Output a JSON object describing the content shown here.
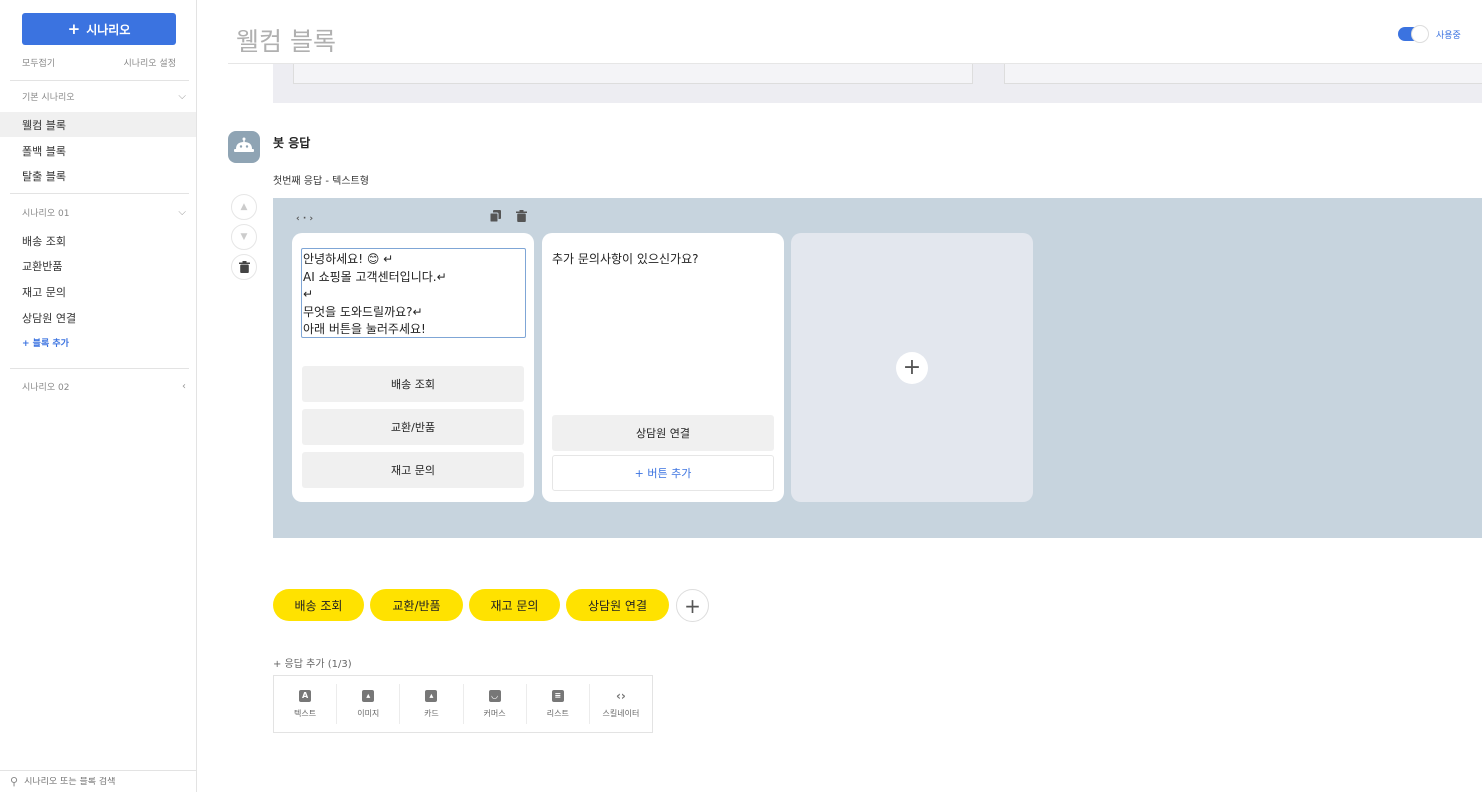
{
  "sidebar": {
    "new_button": "시나리오",
    "collapse_all": "모두접기",
    "scenario_settings": "시나리오 설정",
    "groups": [
      {
        "title": "기본 시나리오",
        "items": [
          "웰컴 블록",
          "폴백 블록",
          "탈출 블록"
        ]
      },
      {
        "title": "시나리오 01",
        "items": [
          "배송 조회",
          "교환반품",
          "재고 문의",
          "상담원 연결"
        ],
        "add_label": "+ 블록 추가"
      },
      {
        "title": "시나리오 02"
      }
    ],
    "search_placeholder": "시나리오 또는 블록 검색"
  },
  "header": {
    "title": "웰컴 블록",
    "toggle_label": "사용중"
  },
  "bot": {
    "label": "봇 응답",
    "response_label": "첫번째 응답 - 텍스트형",
    "cards": [
      {
        "text": "안녕하세요! 😊 ↵\nAI 쇼핑몰 고객센터입니다.↵\n↵\n무엇을 도와드릴까요?↵\n아래 버튼을 눌러주세요!",
        "buttons": [
          "배송 조회",
          "교환/반품",
          "재고 문의"
        ]
      },
      {
        "text": "추가 문의사항이 있으신가요?",
        "buttons": [
          "상담원 연결"
        ],
        "add_button": "+ 버튼 추가"
      }
    ]
  },
  "quick_replies": [
    "배송 조회",
    "교환/반품",
    "재고 문의",
    "상담원 연결"
  ],
  "add_response": {
    "label": "+ 응답 추가 (1/3)",
    "types": [
      "텍스트",
      "이미지",
      "카드",
      "커머스",
      "리스트",
      "스킬네이터"
    ]
  },
  "colors": {
    "primary": "#3b73e0",
    "quick_reply": "#ffe200",
    "canvas": "#c7d4de"
  }
}
